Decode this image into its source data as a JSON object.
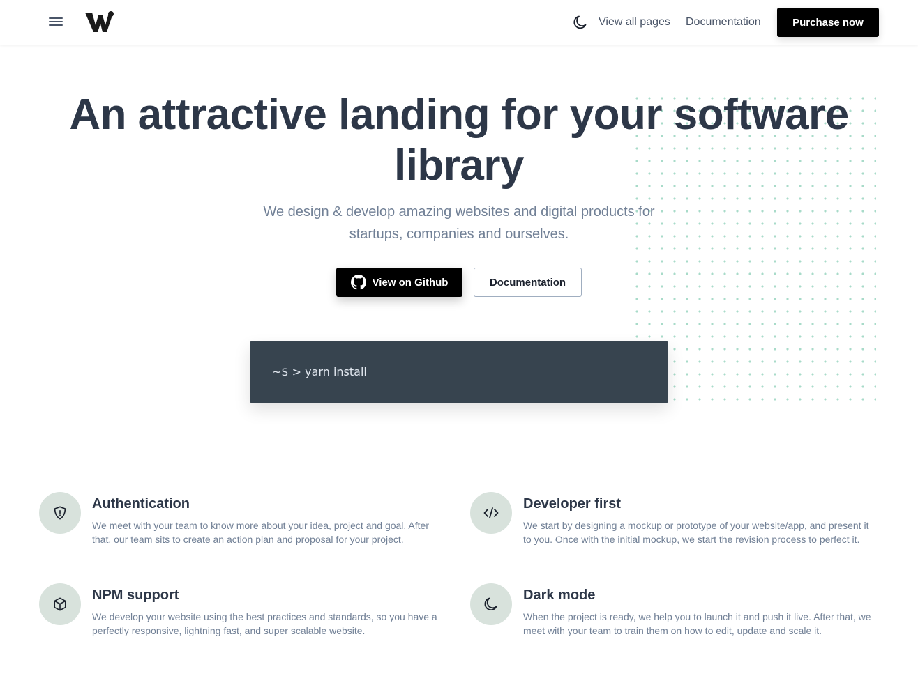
{
  "header": {
    "nav": {
      "view_all_pages": "View all pages",
      "documentation": "Documentation"
    },
    "purchase_label": "Purchase now",
    "icons": [
      "menu-icon",
      "brand-logo",
      "moon-icon"
    ]
  },
  "hero": {
    "title": "An attractive landing for your software library",
    "subtitle": "We design & develop amazing websites and digital products for startups, companies and ourselves.",
    "github_label": "View on Github",
    "docs_label": "Documentation",
    "terminal_text": "~$ > yarn install"
  },
  "features": [
    {
      "title": "Authentication",
      "description": "We meet with your team to know more about your idea, project and goal. After that, our team sits to create an action plan and proposal for your project.",
      "icon": "shield-icon"
    },
    {
      "title": "Developer first",
      "description": "We start by designing a mockup or prototype of your website/app, and present it to you. Once with the initial mockup, we start the revision process to perfect it.",
      "icon": "code-icon"
    },
    {
      "title": "NPM support",
      "description": "We develop your website using the best practices and standards, so you have a perfectly responsive, lightning fast, and super scalable website.",
      "icon": "cube-icon"
    },
    {
      "title": "Dark mode",
      "description": "When the project is ready, we help you to launch it and push it live. After that, we meet with your team to train them on how to edit, update and scale it.",
      "icon": "moon-icon"
    }
  ],
  "colors": {
    "primary_button": "#000000",
    "heading": "#2d3748",
    "body_text": "#718096",
    "terminal_bg": "#37444f",
    "dots": "#a8dbc9",
    "icon_circle": "#d8e2dc"
  }
}
